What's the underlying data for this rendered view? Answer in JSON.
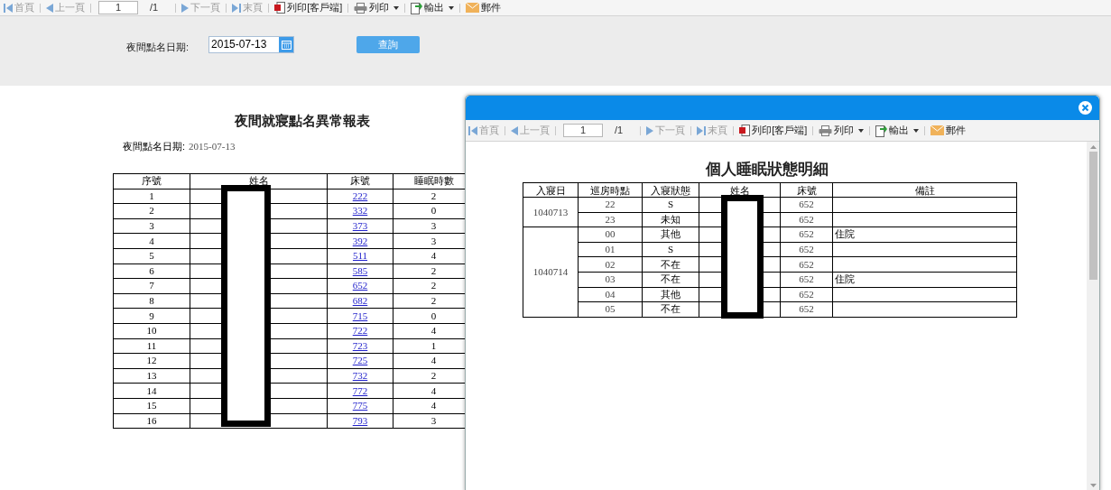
{
  "toolbar": {
    "items": [
      {
        "kind": "first",
        "label": "首頁",
        "disabled": true
      },
      {
        "kind": "prev",
        "label": "上一頁",
        "disabled": true
      },
      {
        "kind": "page",
        "value": "1",
        "total": "/1"
      },
      {
        "kind": "next",
        "label": "下一頁",
        "disabled": true
      },
      {
        "kind": "last",
        "label": "末頁",
        "disabled": true
      },
      {
        "kind": "client-print",
        "label": "列印[客戶端]",
        "disabled": false
      },
      {
        "kind": "print",
        "label": "列印",
        "disabled": false
      },
      {
        "kind": "export",
        "label": "輸出",
        "disabled": false
      },
      {
        "kind": "mail",
        "label": "郵件",
        "disabled": false
      }
    ]
  },
  "filter": {
    "label": "夜間點名日期:",
    "date": "2015-07-13",
    "button": "查詢"
  },
  "report": {
    "title": "夜間就寢點名異常報表",
    "date_label": "夜間點名日期:",
    "date": "2015-07-13",
    "columns": [
      "序號",
      "姓名",
      "床號",
      "睡眠時數"
    ],
    "rows": [
      [
        "1",
        "",
        "222",
        "2"
      ],
      [
        "2",
        "",
        "332",
        "0"
      ],
      [
        "3",
        "",
        "373",
        "3"
      ],
      [
        "4",
        "",
        "392",
        "3"
      ],
      [
        "5",
        "",
        "511",
        "4"
      ],
      [
        "6",
        "",
        "585",
        "2"
      ],
      [
        "7",
        "",
        "652",
        "2"
      ],
      [
        "8",
        "",
        "682",
        "2"
      ],
      [
        "9",
        "",
        "715",
        "0"
      ],
      [
        "10",
        "",
        "722",
        "4"
      ],
      [
        "11",
        "",
        "723",
        "1"
      ],
      [
        "12",
        "",
        "725",
        "4"
      ],
      [
        "13",
        "",
        "732",
        "2"
      ],
      [
        "14",
        "",
        "772",
        "4"
      ],
      [
        "15",
        "",
        "775",
        "4"
      ],
      [
        "16",
        "",
        "793",
        "3"
      ]
    ]
  },
  "dialog": {
    "toolbar": {
      "items": [
        {
          "kind": "first",
          "label": "首頁",
          "disabled": true
        },
        {
          "kind": "prev",
          "label": "上一頁",
          "disabled": true
        },
        {
          "kind": "page",
          "value": "1",
          "total": "/1"
        },
        {
          "kind": "next",
          "label": "下一頁",
          "disabled": true
        },
        {
          "kind": "last",
          "label": "末頁",
          "disabled": true
        },
        {
          "kind": "client-print",
          "label": "列印[客戶端]",
          "disabled": false
        },
        {
          "kind": "print",
          "label": "列印",
          "disabled": false
        },
        {
          "kind": "export",
          "label": "輸出",
          "disabled": false
        },
        {
          "kind": "mail",
          "label": "郵件",
          "disabled": false
        }
      ]
    },
    "title": "個人睡眠狀態明細",
    "columns": [
      "入寢日",
      "巡房時點",
      "入寢狀態",
      "姓名",
      "床號",
      "備註"
    ],
    "groups": [
      {
        "date": "1040713",
        "rows": [
          {
            "time": "22",
            "status": "S",
            "bed": "652",
            "note": ""
          },
          {
            "time": "23",
            "status": "未知",
            "bed": "652",
            "note": ""
          }
        ]
      },
      {
        "date": "1040714",
        "rows": [
          {
            "time": "00",
            "status": "其他",
            "bed": "652",
            "note": "住院"
          },
          {
            "time": "01",
            "status": "S",
            "bed": "652",
            "note": ""
          },
          {
            "time": "02",
            "status": "不在",
            "bed": "652",
            "note": ""
          },
          {
            "time": "03",
            "status": "不在",
            "bed": "652",
            "note": "住院"
          },
          {
            "time": "04",
            "status": "其他",
            "bed": "652",
            "note": ""
          },
          {
            "time": "05",
            "status": "不在",
            "bed": "652",
            "note": ""
          }
        ]
      }
    ]
  }
}
